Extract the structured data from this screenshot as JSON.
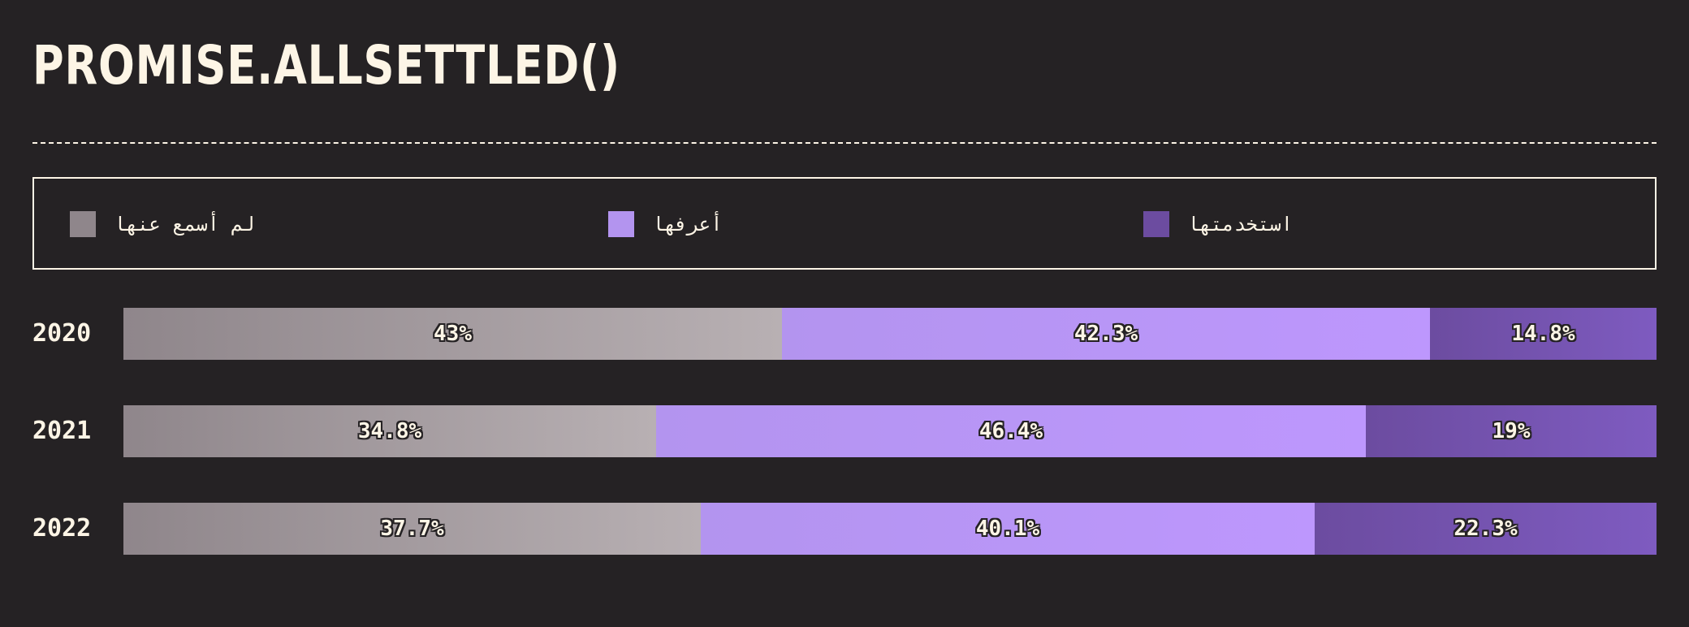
{
  "title": "PROMISE.ALLSETTLED()",
  "colors": {
    "background": "#252224",
    "text": "#fdf5e6",
    "never_heard": "#8f868b",
    "know_it": "#b394ef",
    "used_it": "#6c4ca0"
  },
  "legend": [
    {
      "label": "لم أسمع عنها",
      "color": "#8f868b"
    },
    {
      "label": "أعرفها",
      "color": "#b394ef"
    },
    {
      "label": "استخدمتها",
      "color": "#6c4ca0"
    }
  ],
  "chart_data": {
    "type": "bar",
    "orientation": "horizontal",
    "stacked": true,
    "normalized": true,
    "title": "PROMISE.ALLSETTLED()",
    "categories": [
      "2020",
      "2021",
      "2022"
    ],
    "series": [
      {
        "name": "لم أسمع عنها",
        "values": [
          43,
          34.8,
          37.7
        ],
        "labels": [
          "43%",
          "34.8%",
          "37.7%"
        ]
      },
      {
        "name": "أعرفها",
        "values": [
          42.3,
          46.4,
          40.1
        ],
        "labels": [
          "42.3%",
          "46.4%",
          "40.1%"
        ]
      },
      {
        "name": "استخدمتها",
        "values": [
          14.8,
          19,
          22.3
        ],
        "labels": [
          "14.8%",
          "19%",
          "22.3%"
        ]
      }
    ],
    "legend_position": "top"
  }
}
